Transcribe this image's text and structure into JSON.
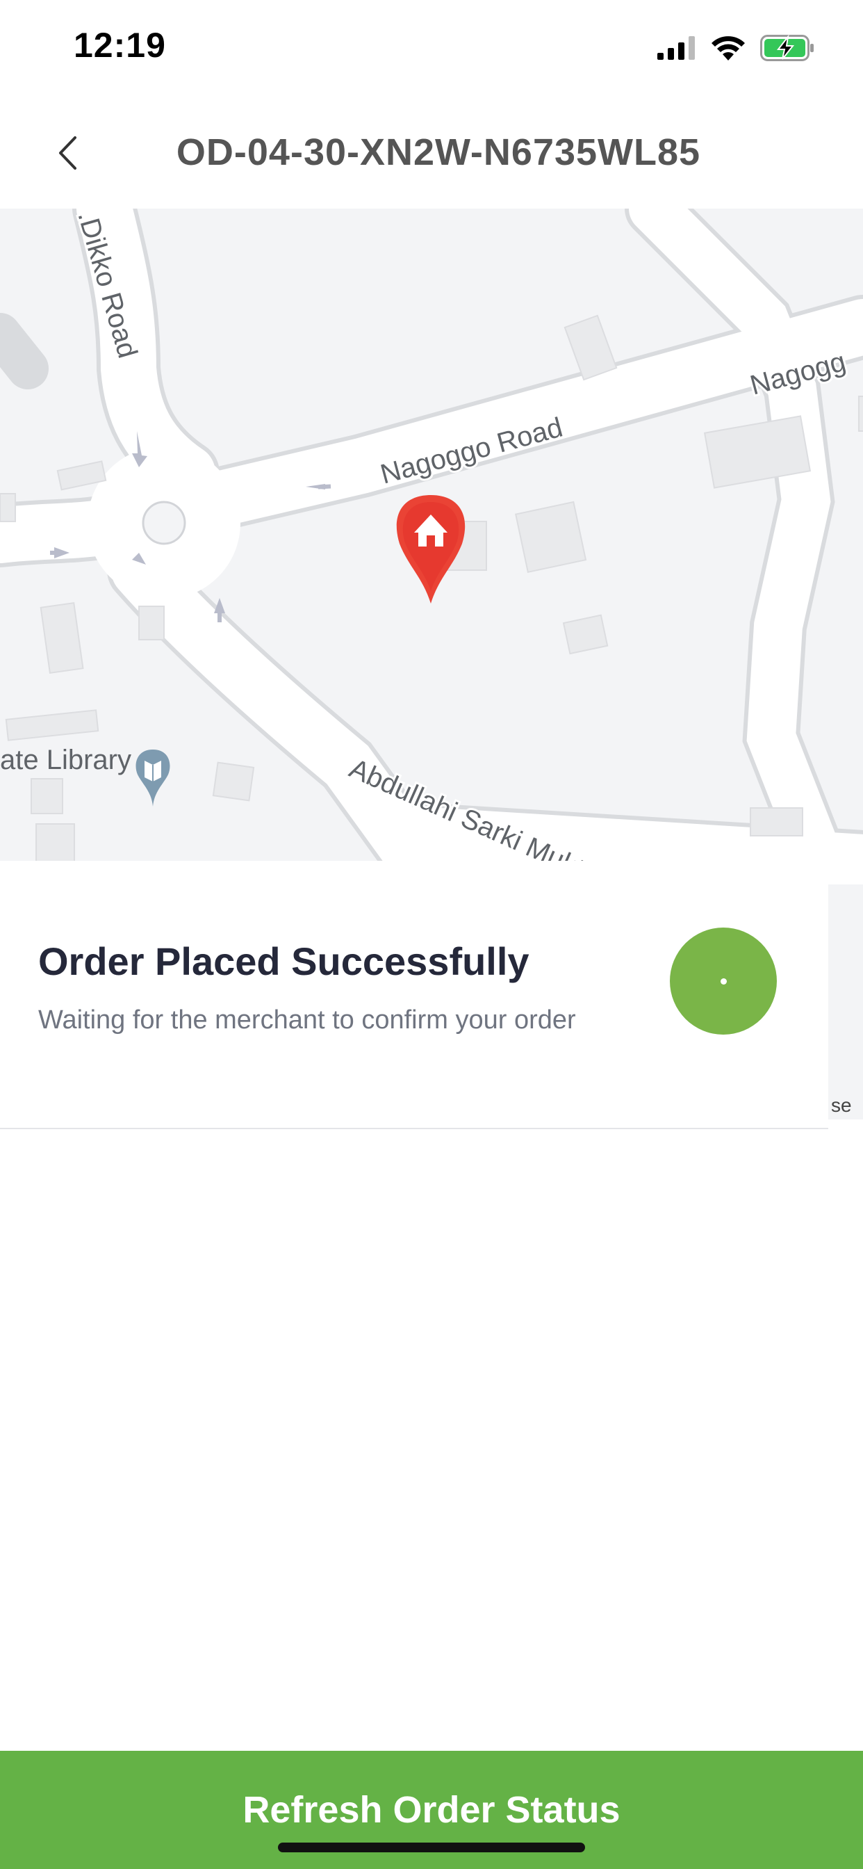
{
  "status_bar": {
    "time": "12:19",
    "icons": [
      "cellular-signal-icon",
      "wifi-icon",
      "battery-charging-icon"
    ]
  },
  "header": {
    "back_icon": "chevron-left-icon",
    "title": "OD-04-30-XN2W-N6735WL85"
  },
  "map": {
    "labels": {
      "dikko_road": ".Dikko Road",
      "nagoggo_road": "Nagoggo Road",
      "nagoggo_road_edge": "Nagogg",
      "abdullahi_road": "Abdullahi Sarki Muktar Road",
      "library": "ate Library"
    },
    "marker_icon": "home-map-pin-icon",
    "poi_icon": "library-book-pin-icon",
    "side_fragment_text": "se"
  },
  "order_status": {
    "title": "Order Placed Successfully",
    "subtitle": "Waiting for the merchant to confirm your order",
    "indicator_color": "#7ab548"
  },
  "refresh_button": {
    "label": "Refresh Order Status",
    "color": "#64b246"
  }
}
